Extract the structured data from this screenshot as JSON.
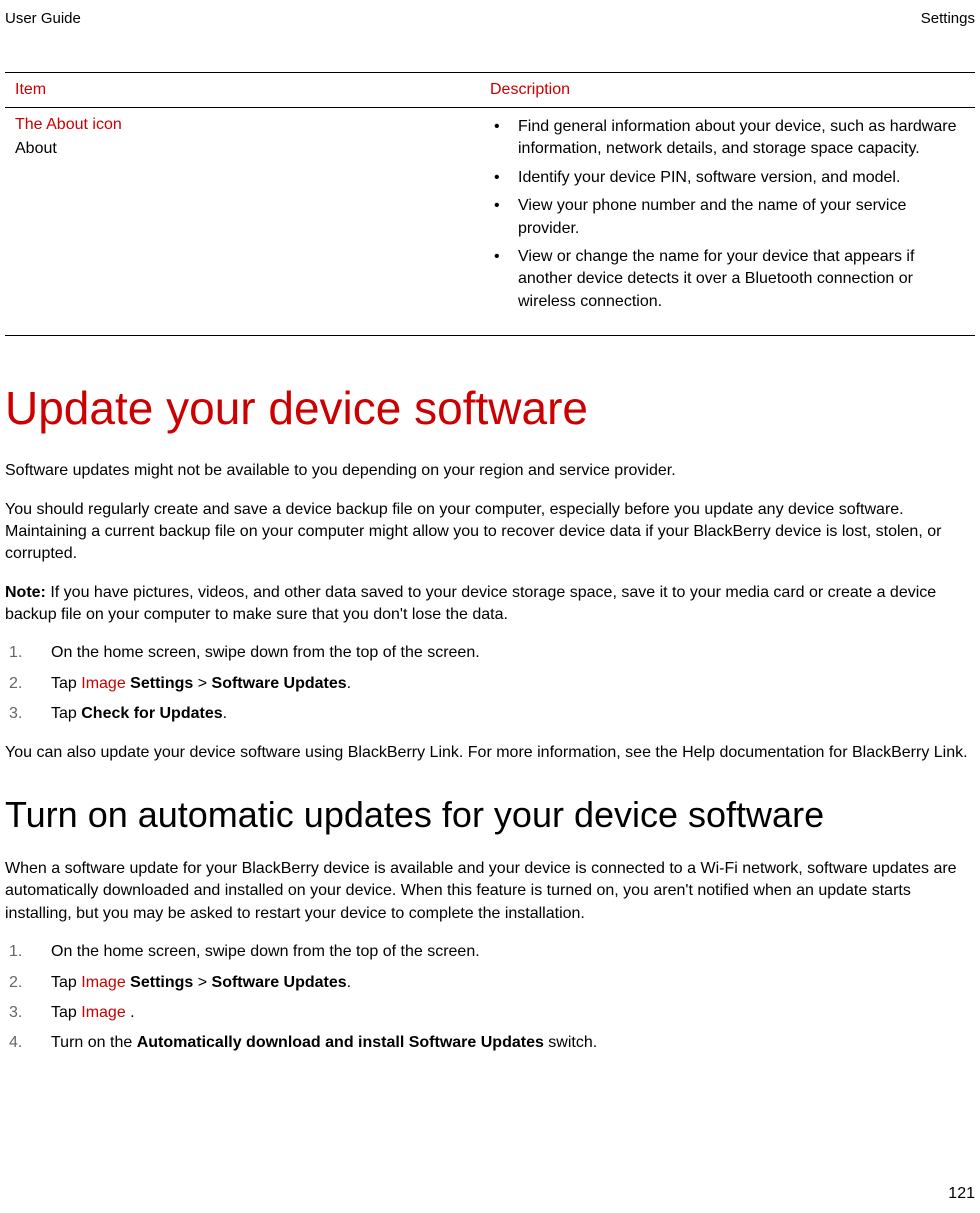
{
  "header": {
    "left": "User Guide",
    "right": "Settings"
  },
  "table": {
    "col1_header": "Item",
    "col2_header": "Description",
    "row": {
      "icon_label": "The About icon",
      "item_label": "About",
      "desc": [
        "Find general information about your device, such as hardware information, network details, and storage space capacity.",
        "Identify your device PIN, software version, and model.",
        "View your phone number and the name of your service provider.",
        "View or change the name for your device that appears if another device detects it over a Bluetooth connection or wireless connection."
      ]
    }
  },
  "section1": {
    "heading": "Update your device software",
    "para1": "Software updates might not be available to you depending on your region and service provider.",
    "para2": "You should regularly create and save a device backup file on your computer, especially before you update any device software. Maintaining a current backup file on your computer might allow you to recover device data if your BlackBerry device is lost, stolen, or corrupted.",
    "note_label": "Note:",
    "note_text": " If you have pictures, videos, and other data saved to your device storage space, save it to your media card or create a device backup file on your computer to make sure that you don't lose the data.",
    "steps": {
      "s1": "On the home screen, swipe down from the top of the screen.",
      "s2_pre": "Tap ",
      "s2_img": "Image",
      "s2_mid": " ",
      "s2_settings": "Settings",
      "s2_gt": " > ",
      "s2_su": "Software Updates",
      "s2_end": ".",
      "s3_pre": "Tap ",
      "s3_bold": "Check for Updates",
      "s3_end": "."
    },
    "para3": "You can also update your device software using BlackBerry Link. For more information, see the Help documentation for BlackBerry Link."
  },
  "section2": {
    "heading": "Turn on automatic updates for your device software",
    "para1": "When a software update for your BlackBerry device is available and your device is connected to a Wi-Fi network, software updates are automatically downloaded and installed on your device. When this feature is turned on, you aren't notified when an update starts installing, but you may be asked to restart your device to complete the installation.",
    "steps": {
      "s1": "On the home screen, swipe down from the top of the screen.",
      "s2_pre": "Tap ",
      "s2_img": "Image",
      "s2_mid": " ",
      "s2_settings": "Settings",
      "s2_gt": " > ",
      "s2_su": "Software Updates",
      "s2_end": ".",
      "s3_pre": "Tap ",
      "s3_img": "Image",
      "s3_end": " .",
      "s4_pre": "Turn on the ",
      "s4_bold": "Automatically download and install Software Updates",
      "s4_end": " switch."
    }
  },
  "page_number": "121"
}
